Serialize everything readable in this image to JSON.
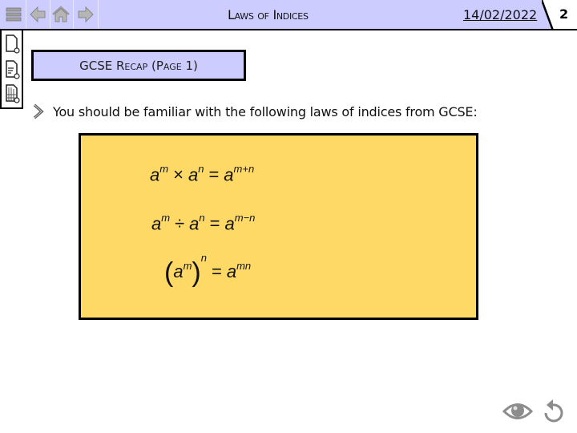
{
  "header": {
    "title": "Laws of Indices",
    "date": "14/02/2022",
    "page_number": "2",
    "nav_buttons": [
      {
        "icon": "menu-icon",
        "label": "Menu"
      },
      {
        "icon": "back-arrow-icon",
        "label": "Back"
      },
      {
        "icon": "home-icon",
        "label": "Home"
      },
      {
        "icon": "forward-arrow-icon",
        "label": "Forward"
      }
    ]
  },
  "sidebar": {
    "items": [
      {
        "icon": "blank-page-icon"
      },
      {
        "icon": "text-page-icon"
      },
      {
        "icon": "grid-page-icon"
      }
    ]
  },
  "section": {
    "title": "GCSE Recap (Page 1)"
  },
  "content": {
    "bullet_icon": "chevron-right-icon",
    "bullet_text": "You should be familiar with the following laws of indices from GCSE:",
    "formulas": [
      {
        "lhs_base1": "a",
        "lhs_exp1": "m",
        "operator": "×",
        "lhs_base2": "a",
        "lhs_exp2": "n",
        "equals": "=",
        "rhs_base": "a",
        "rhs_exp": "m+n"
      },
      {
        "lhs_base1": "a",
        "lhs_exp1": "m",
        "operator": "÷",
        "lhs_base2": "a",
        "lhs_exp2": "n",
        "equals": "=",
        "rhs_base": "a",
        "rhs_exp": "m−n"
      },
      {
        "open_paren": "(",
        "lhs_base1": "a",
        "lhs_exp1": "m",
        "close_paren": ")",
        "outer_exp": "n",
        "equals": "=",
        "rhs_base": "a",
        "rhs_exp": "mn"
      }
    ],
    "box_color": "#ffd966"
  },
  "footer": {
    "buttons": [
      {
        "icon": "eye-icon",
        "label": "Reveal"
      },
      {
        "icon": "reset-icon",
        "label": "Reset"
      }
    ]
  },
  "colors": {
    "header_bg": "#ccccff",
    "icon_gray": "#8c8c8c"
  }
}
